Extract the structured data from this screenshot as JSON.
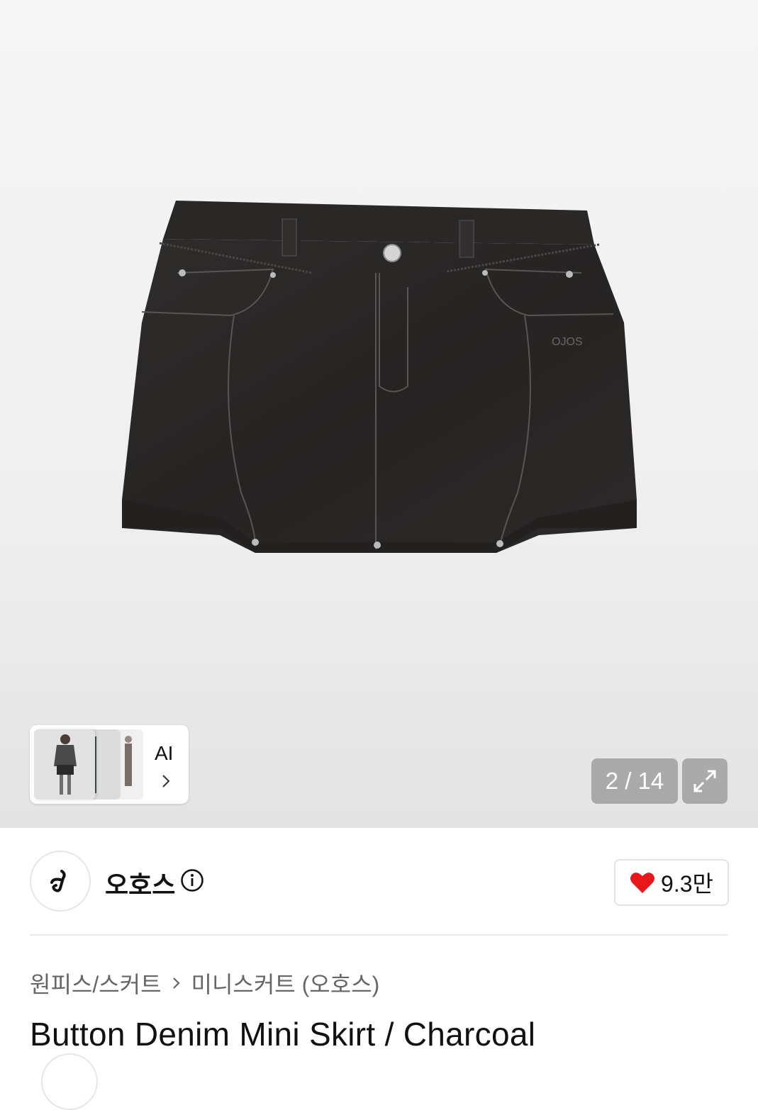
{
  "gallery": {
    "ai_label": "AI",
    "counter": "2 / 14",
    "product_logo_text": "OJOS"
  },
  "brand": {
    "name": "오호스",
    "like_count": "9.3만"
  },
  "breadcrumb": {
    "category": "원피스/스커트",
    "subcategory": "미니스커트 (오호스)"
  },
  "product": {
    "title": "Button Denim Mini Skirt / Charcoal"
  },
  "colors": {
    "heart": "#e8171b",
    "denim": "#2a2727"
  },
  "icons": [
    "chevron-right-icon",
    "expand-icon",
    "info-icon",
    "heart-icon",
    "brand-logo-icon"
  ]
}
